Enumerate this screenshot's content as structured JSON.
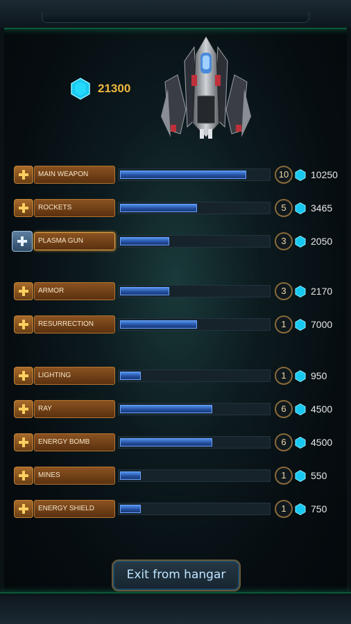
{
  "currency": {
    "amount": "21300",
    "icon": "blue-hex-gem-icon",
    "color": "#20d8ff"
  },
  "upgrades": [
    {
      "name": "MAIN WEAPON",
      "level": "10",
      "cost": "10250",
      "progress": 0.85
    },
    {
      "name": "ROCKETS",
      "level": "5",
      "cost": "3465",
      "progress": 0.52
    },
    {
      "name": "PLASMA GUN",
      "level": "3",
      "cost": "2050",
      "progress": 0.33,
      "selected": true
    },
    {
      "name": "ARMOR",
      "level": "3",
      "cost": "2170",
      "progress": 0.33
    },
    {
      "name": "RESURRECTION",
      "level": "1",
      "cost": "7000",
      "progress": 0.52
    },
    {
      "name": "LIGHTING",
      "level": "1",
      "cost": "950",
      "progress": 0.14
    },
    {
      "name": "RAY",
      "level": "6",
      "cost": "4500",
      "progress": 0.62
    },
    {
      "name": "ENERGY BOMB",
      "level": "6",
      "cost": "4500",
      "progress": 0.62
    },
    {
      "name": "MINES",
      "level": "1",
      "cost": "550",
      "progress": 0.14
    },
    {
      "name": "ENERGY SHIELD",
      "level": "1",
      "cost": "750",
      "progress": 0.14
    }
  ],
  "exit_button": {
    "label": "Exit from hangar"
  },
  "colors": {
    "accent_orange": "#b57530",
    "bar_blue": "#2f6bd0",
    "gem_cyan": "#20d8ff"
  }
}
